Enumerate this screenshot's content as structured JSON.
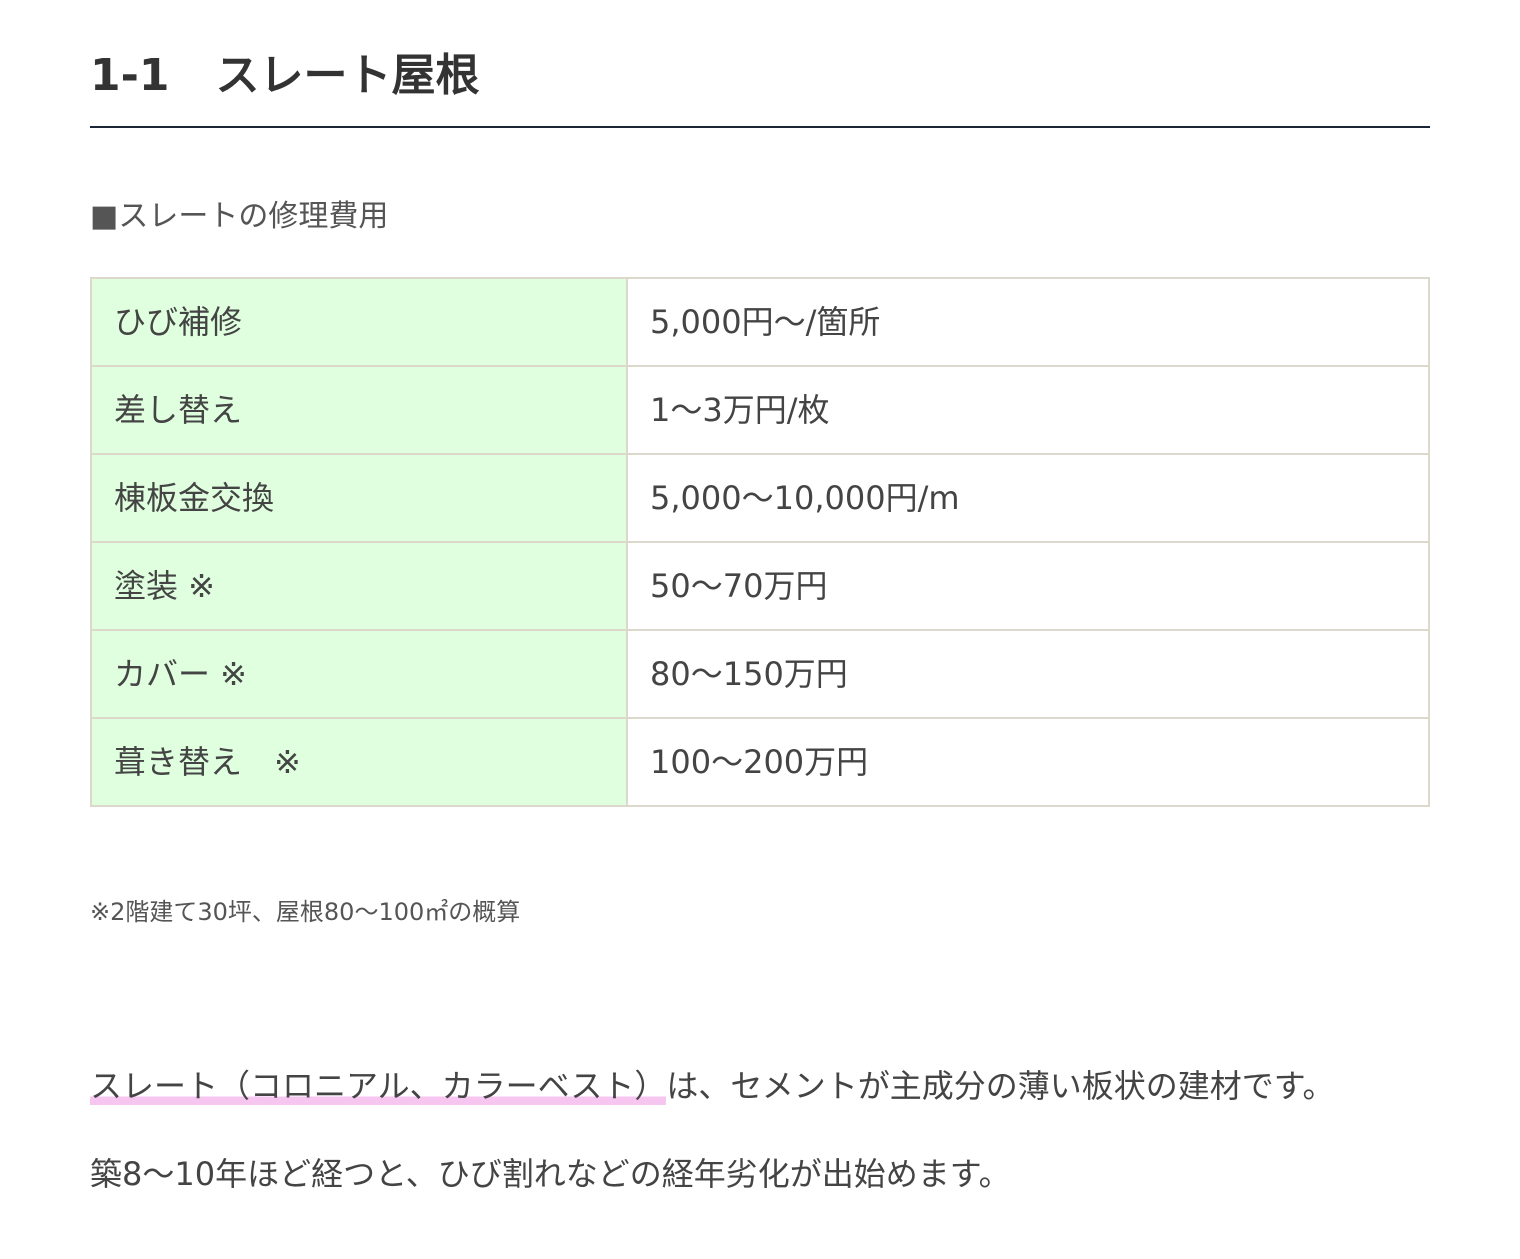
{
  "heading": {
    "number": "1-1",
    "title": "スレート屋根"
  },
  "subheading": "■スレートの修理費用",
  "price_table": {
    "rows": [
      {
        "item": "ひび補修",
        "price": "5,000円〜/箇所"
      },
      {
        "item": "差し替え",
        "price": "1〜3万円/枚"
      },
      {
        "item": "棟板金交換",
        "price": "5,000〜10,000円/m"
      },
      {
        "item": "塗装 ※",
        "price": "50〜70万円"
      },
      {
        "item": "カバー ※",
        "price": "80〜150万円"
      },
      {
        "item": "葺き替え　※",
        "price": "100〜200万円"
      }
    ]
  },
  "footnote": "※2階建て30坪、屋根80〜100㎡の概算",
  "paragraphs": {
    "p1_highlight": "スレート（コロニアル、カラーベスト）",
    "p1_rest": "は、セメントが主成分の薄い板状の建材です。",
    "p2": "築8〜10年ほど経つと、ひび割れなどの経年劣化が出始めます。"
  },
  "colors": {
    "label_cell_bg": "#dfffdf",
    "table_border": "#ddd8cc",
    "heading_rule": "#1c2536",
    "highlight_marker": "#f7c6f0"
  }
}
